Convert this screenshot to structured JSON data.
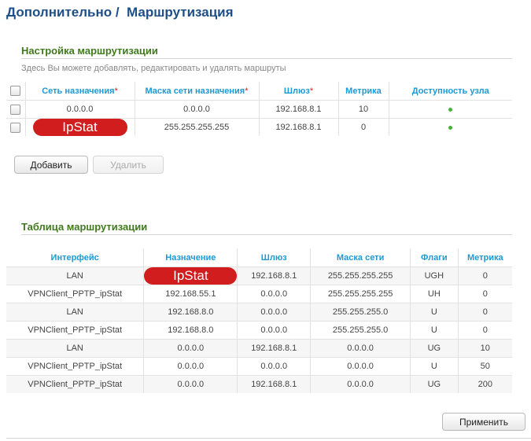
{
  "breadcrumb": {
    "part1": "Дополнительно",
    "sep": " /  ",
    "part2": "Маршрутизация"
  },
  "routes_config": {
    "title": "Настройка маршрутизации",
    "hint": "Здесь Вы можете добавлять, редактировать и удалять маршруты",
    "headers": {
      "network": "Сеть назначения",
      "mask": "Маска сети назначения",
      "gateway": "Шлюз",
      "metric": "Метрика",
      "availability": "Доступность узла",
      "required_mark": "*"
    },
    "rows": [
      {
        "network": "0.0.0.0",
        "mask": "0.0.0.0",
        "gateway": "192.168.8.1",
        "metric": "10",
        "status": "available"
      },
      {
        "network": "IpStat",
        "mask": "255.255.255.255",
        "gateway": "192.168.8.1",
        "metric": "0",
        "status": "available"
      }
    ],
    "add_button": "Добавить",
    "delete_button": "Удалить"
  },
  "routing_table": {
    "title": "Таблица маршрутизации",
    "headers": {
      "interface": "Интерфейс",
      "destination": "Назначение",
      "gateway": "Шлюз",
      "netmask": "Маска сети",
      "flags": "Флаги",
      "metric": "Метрика"
    },
    "rows": [
      {
        "interface": "LAN",
        "destination": "IpStat",
        "gateway": "192.168.8.1",
        "netmask": "255.255.255.255",
        "flags": "UGH",
        "metric": "0"
      },
      {
        "interface": "VPNClient_PPTP_ipStat",
        "destination": "192.168.55.1",
        "gateway": "0.0.0.0",
        "netmask": "255.255.255.255",
        "flags": "UH",
        "metric": "0"
      },
      {
        "interface": "LAN",
        "destination": "192.168.8.0",
        "gateway": "0.0.0.0",
        "netmask": "255.255.255.0",
        "flags": "U",
        "metric": "0"
      },
      {
        "interface": "VPNClient_PPTP_ipStat",
        "destination": "192.168.8.0",
        "gateway": "0.0.0.0",
        "netmask": "255.255.255.0",
        "flags": "U",
        "metric": "0"
      },
      {
        "interface": "LAN",
        "destination": "0.0.0.0",
        "gateway": "192.168.8.1",
        "netmask": "0.0.0.0",
        "flags": "UG",
        "metric": "10"
      },
      {
        "interface": "VPNClient_PPTP_ipStat",
        "destination": "0.0.0.0",
        "gateway": "0.0.0.0",
        "netmask": "0.0.0.0",
        "flags": "U",
        "metric": "50"
      },
      {
        "interface": "VPNClient_PPTP_ipStat",
        "destination": "0.0.0.0",
        "gateway": "192.168.8.1",
        "netmask": "0.0.0.0",
        "flags": "UG",
        "metric": "200"
      }
    ]
  },
  "apply_button": "Применить",
  "colors": {
    "title": "#1e4f87",
    "section": "#3f7a1c",
    "header": "#1a9ad6",
    "required": "#d31a1a",
    "redaction": "#d11d1d",
    "status_ok": "#46b43a"
  }
}
